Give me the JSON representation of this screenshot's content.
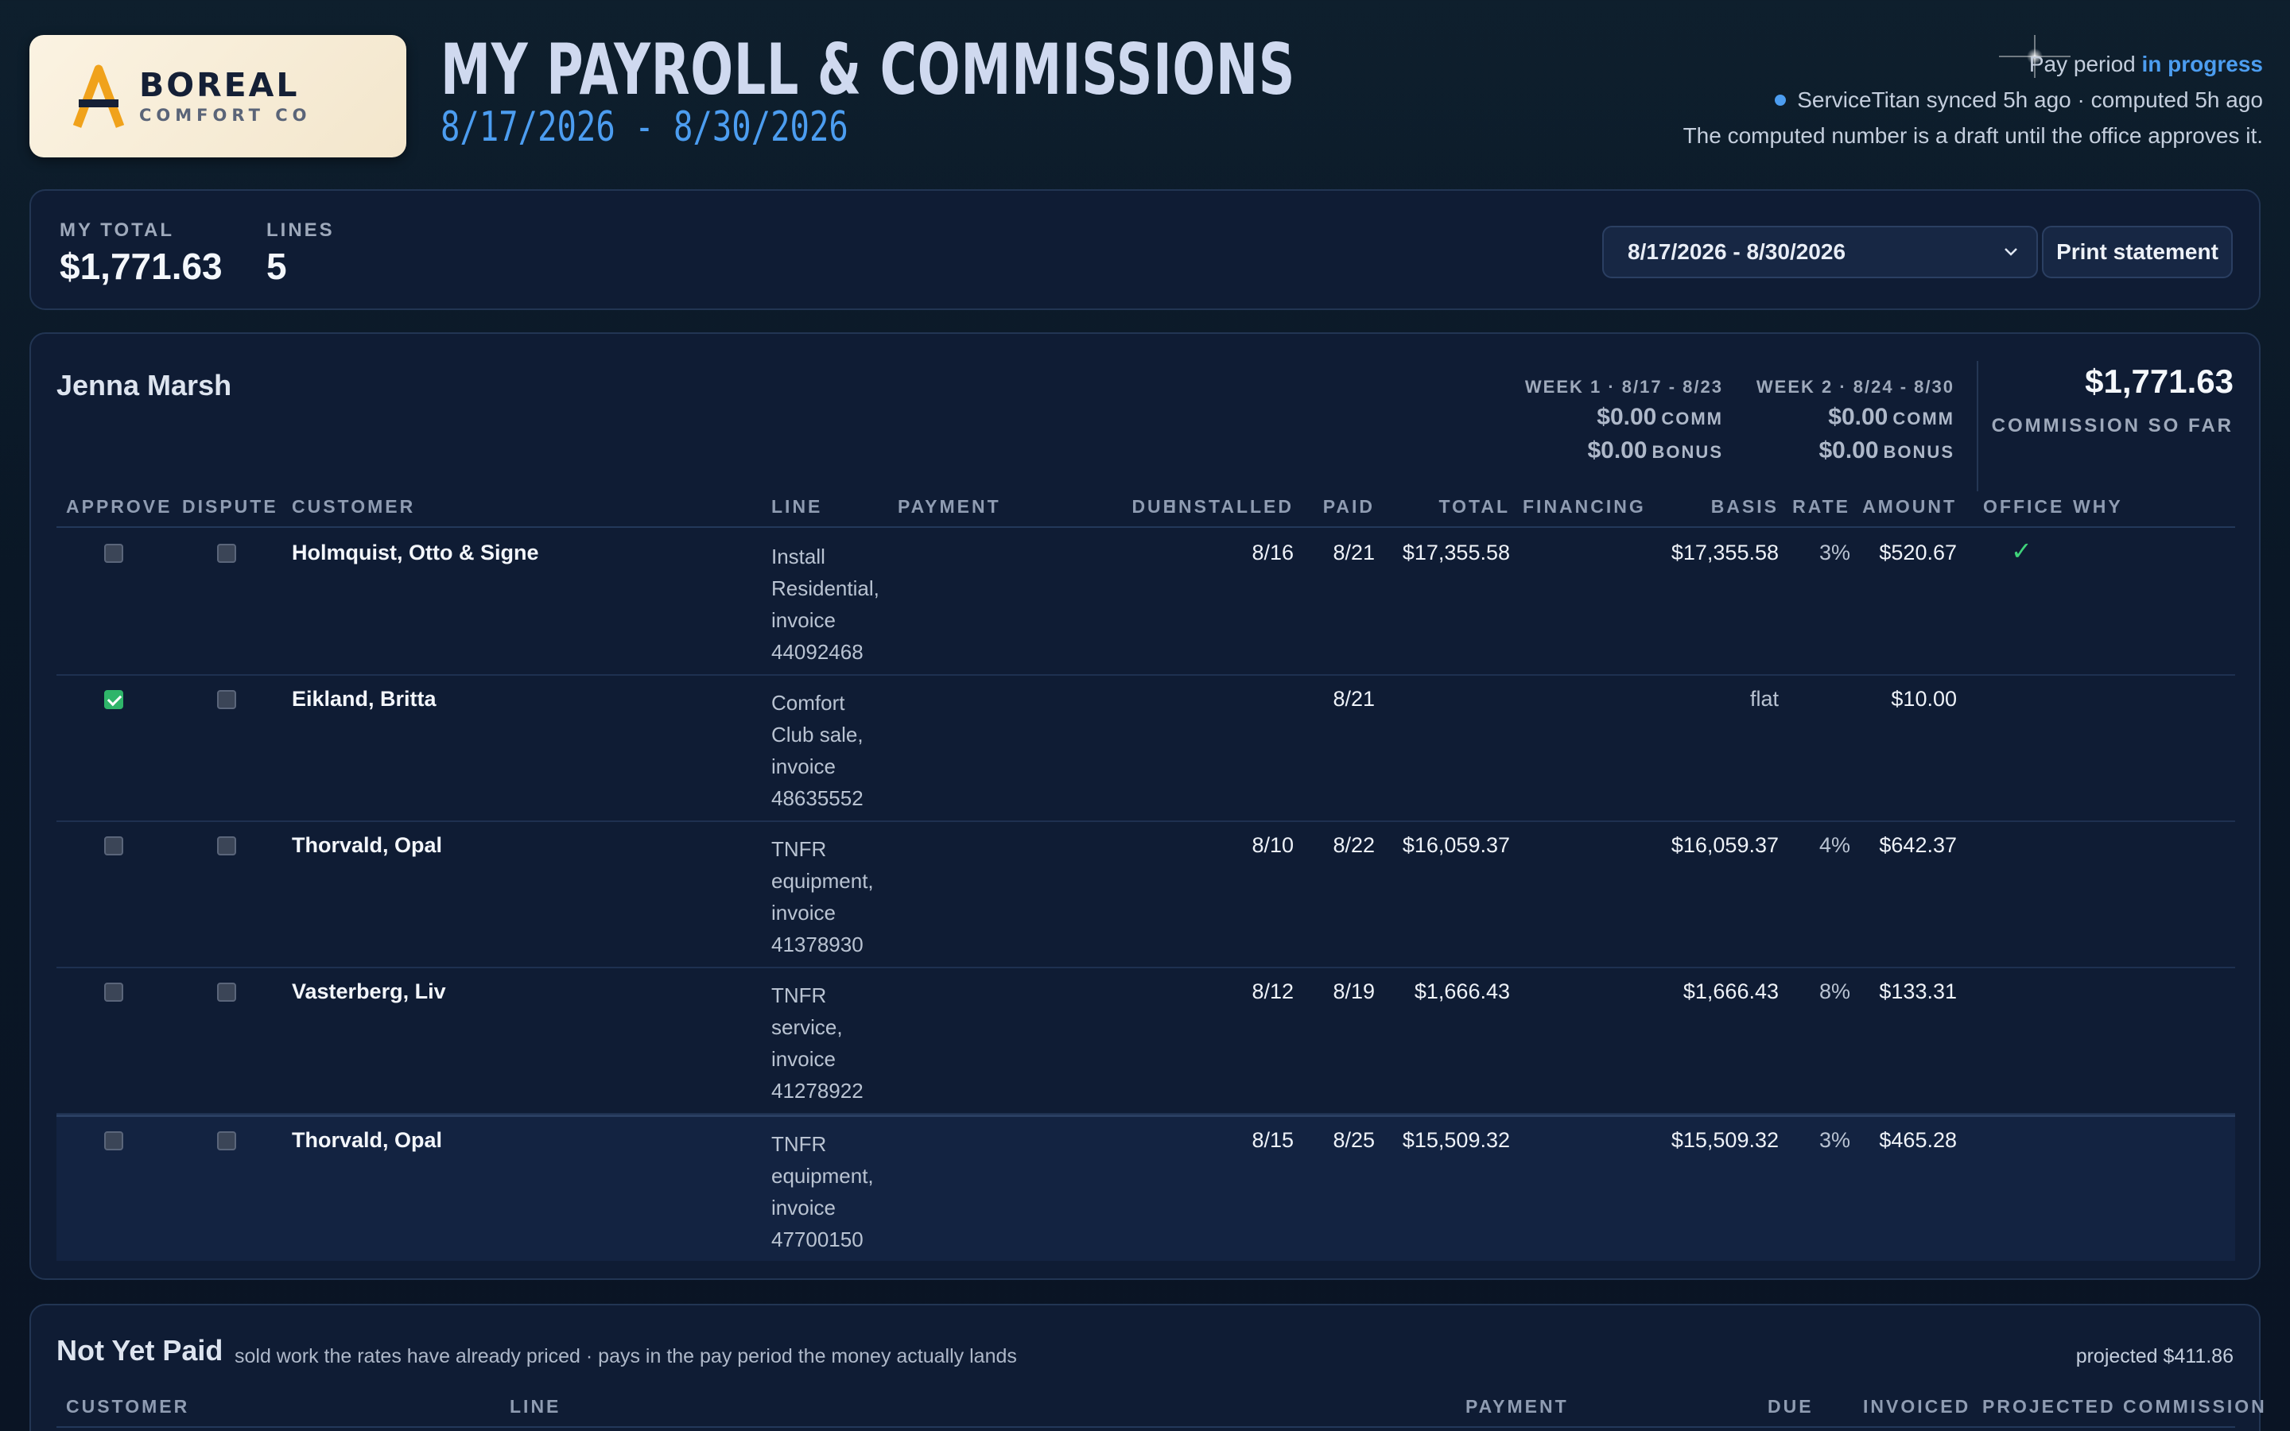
{
  "brand": {
    "name": "BOREAL",
    "tagline": "COMFORT CO",
    "accent_color": "#f0a21b"
  },
  "header": {
    "title": "MY PAYROLL & COMMISSIONS",
    "period": "8/17/2026 - 8/30/2026",
    "status_prefix": "Pay period ",
    "status_value": "in progress",
    "sync_text": "ServiceTitan synced 5h ago · computed 5h ago",
    "draft_note": "The computed number is a draft until the office approves it."
  },
  "summary": {
    "total_label": "MY TOTAL",
    "total_value": "$1,771.63",
    "lines_label": "LINES",
    "lines_value": "5",
    "period_select": "8/17/2026 - 8/30/2026",
    "print_label": "Print statement"
  },
  "commission": {
    "employee": "Jenna Marsh",
    "weeks": [
      {
        "label": "WEEK 1 · 8/17 - 8/23",
        "comm": "$0.00",
        "comm_unit": "COMM",
        "bonus": "$0.00",
        "bonus_unit": "BONUS"
      },
      {
        "label": "WEEK 2 · 8/24 - 8/30",
        "comm": "$0.00",
        "comm_unit": "COMM",
        "bonus": "$0.00",
        "bonus_unit": "BONUS"
      }
    ],
    "so_far_value": "$1,771.63",
    "so_far_label": "COMMISSION SO FAR",
    "columns": [
      "APPROVE",
      "DISPUTE",
      "CUSTOMER",
      "LINE",
      "PAYMENT",
      "DUE",
      "INSTALLED",
      "PAID",
      "TOTAL",
      "FINANCING",
      "BASIS",
      "RATE",
      "AMOUNT",
      "OFFICE",
      "WHY"
    ],
    "rows": [
      {
        "approve": false,
        "dispute": false,
        "customer": "Holmquist, Otto & Signe",
        "line": "Install Residential, invoice 44092468",
        "installed": "8/16",
        "paid": "8/21",
        "total": "$17,355.58",
        "basis": "$17,355.58",
        "rate": "3%",
        "amount": "$520.67",
        "office": "✓"
      },
      {
        "approve": true,
        "dispute": false,
        "customer": "Eikland, Britta",
        "line": "Comfort Club sale, invoice 48635552",
        "installed": "",
        "paid": "8/21",
        "total": "",
        "basis": "flat",
        "rate": "",
        "amount": "$10.00",
        "office": ""
      },
      {
        "approve": false,
        "dispute": false,
        "customer": "Thorvald, Opal",
        "line": "TNFR equipment, invoice 41378930",
        "installed": "8/10",
        "paid": "8/22",
        "total": "$16,059.37",
        "basis": "$16,059.37",
        "rate": "4%",
        "amount": "$642.37",
        "office": ""
      },
      {
        "approve": false,
        "dispute": false,
        "customer": "Vasterberg, Liv",
        "line": "TNFR service, invoice 41278922",
        "installed": "8/12",
        "paid": "8/19",
        "total": "$1,666.43",
        "basis": "$1,666.43",
        "rate": "8%",
        "amount": "$133.31",
        "office": ""
      },
      {
        "approve": false,
        "dispute": false,
        "customer": "Thorvald, Opal",
        "line": "TNFR equipment, invoice 47700150",
        "installed": "8/15",
        "paid": "8/25",
        "total": "$15,509.32",
        "basis": "$15,509.32",
        "rate": "3%",
        "amount": "$465.28",
        "office": ""
      }
    ]
  },
  "not_yet_paid": {
    "title": "Not Yet Paid",
    "description": "sold work the rates have already priced · pays in the pay period the money actually lands",
    "projected": "projected $411.86",
    "columns": [
      "CUSTOMER",
      "LINE",
      "PAYMENT",
      "DUE",
      "INVOICED",
      "PROJECTED COMMISSION"
    ]
  }
}
